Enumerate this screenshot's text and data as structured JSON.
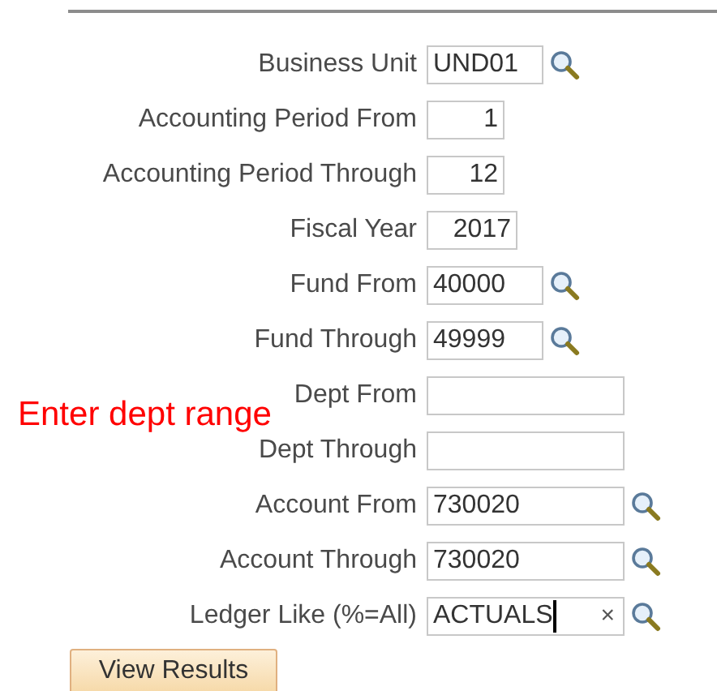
{
  "annotation": "Enter dept range",
  "fields": [
    {
      "label": "Business Unit",
      "kind": "code",
      "value": "UND01",
      "lookup": true
    },
    {
      "label": "Accounting Period From",
      "kind": "number",
      "value": "1",
      "lookup": false
    },
    {
      "label": "Accounting Period Through",
      "kind": "number",
      "value": "12",
      "lookup": false
    },
    {
      "label": "Fiscal Year",
      "kind": "number",
      "value": "2017",
      "lookup": false
    },
    {
      "label": "Fund From",
      "kind": "code",
      "value": "40000",
      "lookup": true
    },
    {
      "label": "Fund Through",
      "kind": "code",
      "value": "49999",
      "lookup": true
    },
    {
      "label": "Dept From",
      "kind": "range",
      "lookup": false
    },
    {
      "label": "Dept Through",
      "kind": "range",
      "lookup": false
    },
    {
      "label": "Account From",
      "kind": "range",
      "value": "730020",
      "lookup": true
    },
    {
      "label": "Account Through",
      "kind": "range",
      "value": "730020",
      "lookup": true
    },
    {
      "label": "Ledger Like (%=All)",
      "kind": "range",
      "value": "ACTUALS",
      "lookup": true,
      "focused": true,
      "clear": "×"
    }
  ],
  "button": "View Results"
}
